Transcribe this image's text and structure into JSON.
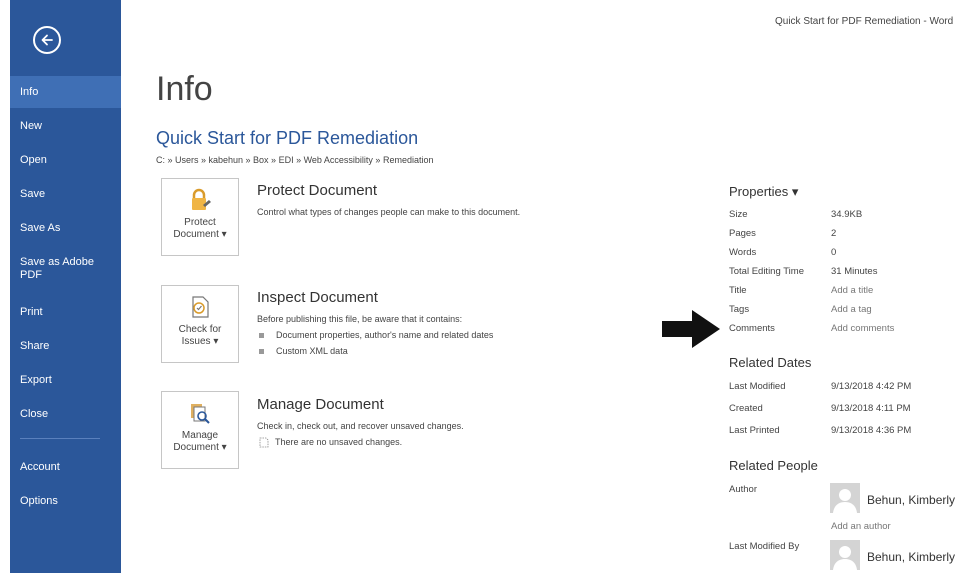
{
  "window": {
    "title": "Quick Start for PDF Remediation - Word"
  },
  "sidebar": {
    "items": [
      {
        "label": "Info"
      },
      {
        "label": "New"
      },
      {
        "label": "Open"
      },
      {
        "label": "Save"
      },
      {
        "label": "Save As"
      },
      {
        "label": "Save as Adobe PDF"
      },
      {
        "label": "Print"
      },
      {
        "label": "Share"
      },
      {
        "label": "Export"
      },
      {
        "label": "Close"
      },
      {
        "label": "Account"
      },
      {
        "label": "Options"
      }
    ]
  },
  "main": {
    "page_title": "Info",
    "doc_title": "Quick Start for PDF Remediation",
    "breadcrumb": "C: » Users » kabehun » Box » EDI » Web Accessibility » Remediation",
    "protect": {
      "button_line1": "Protect",
      "button_line2": "Document ▾",
      "title": "Protect Document",
      "desc": "Control what types of changes people can make to this document."
    },
    "inspect": {
      "button_line1": "Check for",
      "button_line2": "Issues ▾",
      "title": "Inspect Document",
      "desc": "Before publishing this file, be aware that it contains:",
      "bullets": [
        "Document properties, author's name and related dates",
        "Custom XML data"
      ]
    },
    "manage": {
      "button_line1": "Manage",
      "button_line2": "Document ▾",
      "title": "Manage Document",
      "desc": "Check in, check out, and recover unsaved changes.",
      "note": "There are no unsaved changes."
    }
  },
  "properties": {
    "heading": "Properties ▾",
    "rows": [
      {
        "label": "Size",
        "value": "34.9KB"
      },
      {
        "label": "Pages",
        "value": "2"
      },
      {
        "label": "Words",
        "value": "0"
      },
      {
        "label": "Total Editing Time",
        "value": "31 Minutes"
      },
      {
        "label": "Title",
        "value": "Add a title"
      },
      {
        "label": "Tags",
        "value": "Add a tag"
      },
      {
        "label": "Comments",
        "value": "Add comments"
      }
    ]
  },
  "related_dates": {
    "heading": "Related Dates",
    "rows": [
      {
        "label": "Last Modified",
        "value": "9/13/2018 4:42 PM"
      },
      {
        "label": "Created",
        "value": "9/13/2018 4:11 PM"
      },
      {
        "label": "Last Printed",
        "value": "9/13/2018 4:36 PM"
      }
    ]
  },
  "related_people": {
    "heading": "Related People",
    "author_label": "Author",
    "author_name": "Behun, Kimberly",
    "add_author": "Add an author",
    "last_modified_by_label": "Last Modified By",
    "last_modified_by_name": "Behun, Kimberly"
  },
  "colors": {
    "accent": "#2b579a",
    "active_nav": "#3f6fb5"
  }
}
